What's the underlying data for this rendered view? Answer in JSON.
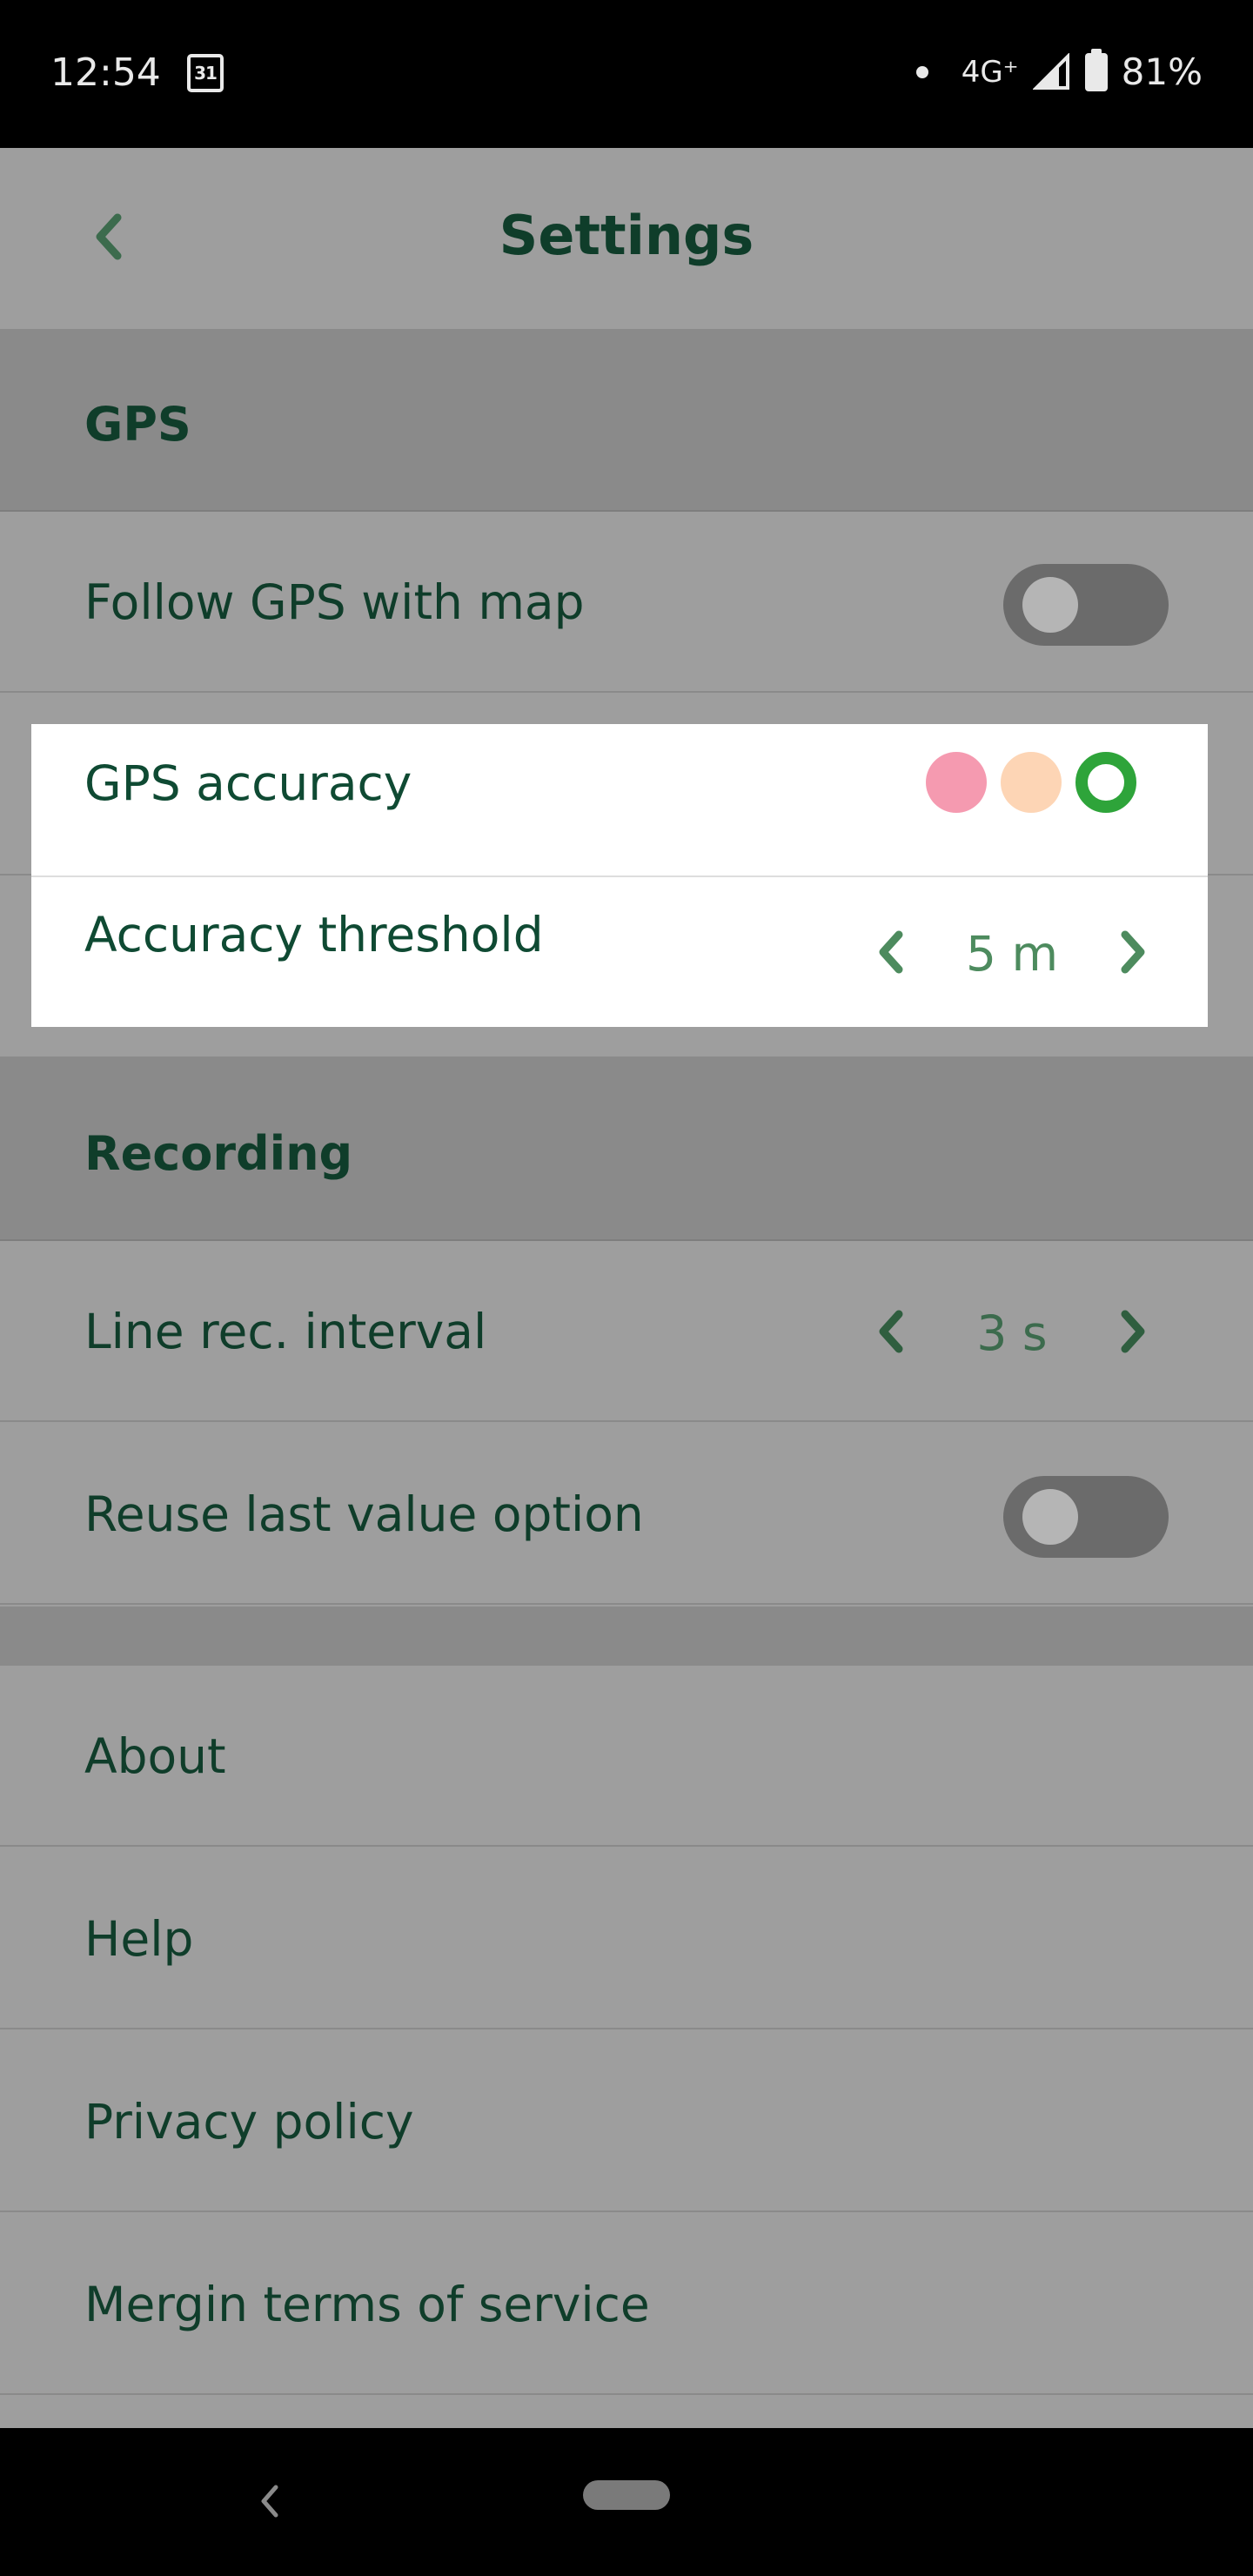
{
  "status_bar": {
    "time": "12:54",
    "calendar_day": "31",
    "network": "4G⁺",
    "battery": "81%"
  },
  "header": {
    "title": "Settings"
  },
  "sections": {
    "gps": {
      "title": "GPS",
      "follow_gps": {
        "label": "Follow GPS with map",
        "enabled": false
      },
      "gps_accuracy": {
        "label": "GPS accuracy",
        "levels": [
          "low",
          "medium",
          "high"
        ],
        "selected": "high"
      },
      "accuracy_threshold": {
        "label": "Accuracy threshold",
        "value": "5 m"
      }
    },
    "recording": {
      "title": "Recording",
      "line_rec_interval": {
        "label": "Line rec. interval",
        "value": "3 s"
      },
      "reuse_last_value": {
        "label": "Reuse last value option",
        "enabled": false
      }
    },
    "info": {
      "items": [
        "About",
        "Help",
        "Privacy policy",
        "Mergin terms of service"
      ]
    }
  },
  "colors": {
    "text_dark_green": "#0f3d2a",
    "accent_green": "#4d8b5e",
    "accuracy_low": "#f59ab0",
    "accuracy_medium": "#fdd5b5",
    "accuracy_high": "#2ea43a"
  }
}
